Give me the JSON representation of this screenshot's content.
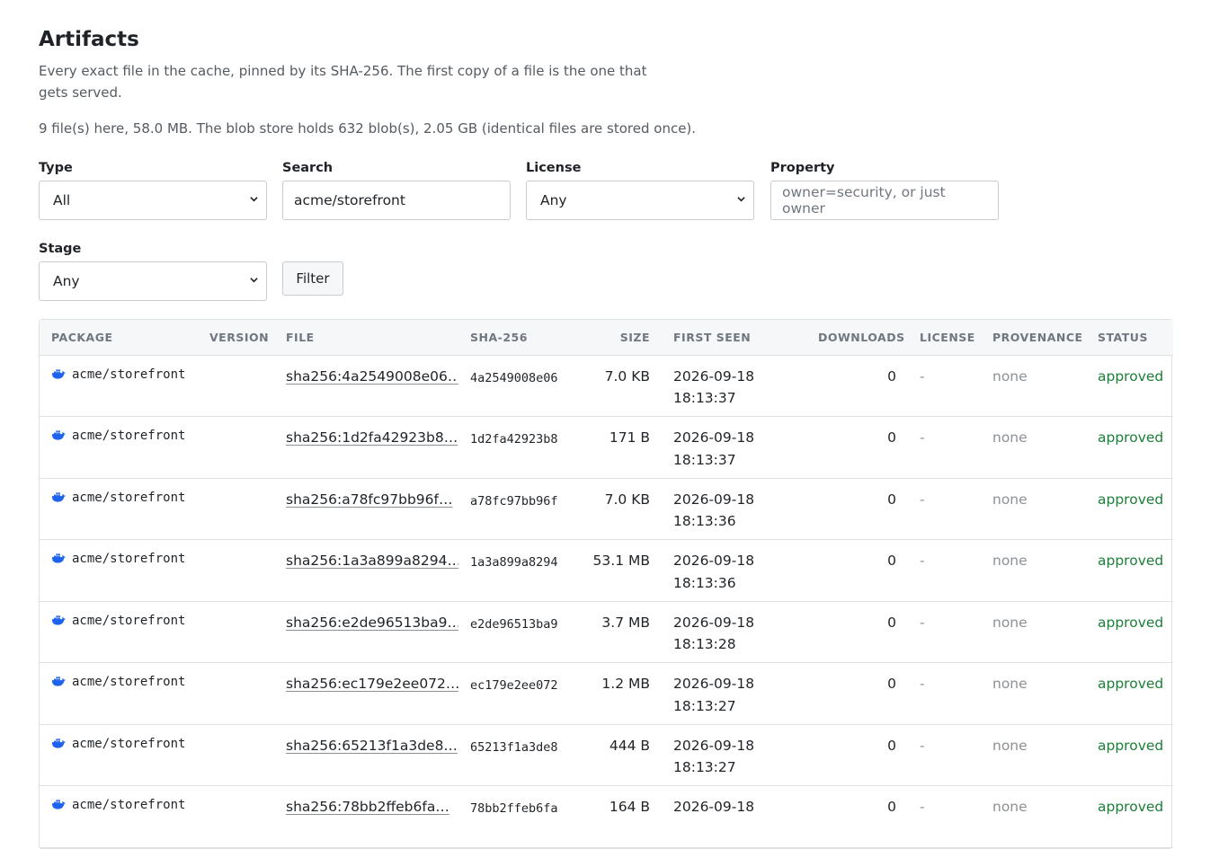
{
  "header": {
    "title": "Artifacts",
    "description": "Every exact file in the cache, pinned by its SHA-256. The first copy of a file is the one that gets served.",
    "stats": "9 file(s) here, 58.0 MB. The blob store holds 632 blob(s), 2.05 GB (identical files are stored once)."
  },
  "filters": {
    "type": {
      "label": "Type",
      "value": "All"
    },
    "search": {
      "label": "Search",
      "value": "acme/storefront"
    },
    "license": {
      "label": "License",
      "value": "Any"
    },
    "property": {
      "label": "Property",
      "placeholder": "owner=security, or just owner"
    },
    "stage": {
      "label": "Stage",
      "value": "Any"
    },
    "filter_button": "Filter"
  },
  "table": {
    "columns": {
      "package": "PACKAGE",
      "version": "VERSION",
      "file": "FILE",
      "sha": "SHA-256",
      "size": "SIZE",
      "first_seen": "FIRST SEEN",
      "downloads": "DOWNLOADS",
      "license": "LICENSE",
      "provenance": "PROVENANCE",
      "status": "STATUS"
    },
    "rows": [
      {
        "package": "acme/storefront",
        "version": "",
        "file": "sha256:4a2549008e06…",
        "sha": "4a2549008e06",
        "size": "7.0 KB",
        "first_seen": "2026-09-18 18:13:37",
        "downloads": "0",
        "license": "-",
        "provenance": "none",
        "status": "approved"
      },
      {
        "package": "acme/storefront",
        "version": "",
        "file": "sha256:1d2fa42923b8…",
        "sha": "1d2fa42923b8",
        "size": "171 B",
        "first_seen": "2026-09-18 18:13:37",
        "downloads": "0",
        "license": "-",
        "provenance": "none",
        "status": "approved"
      },
      {
        "package": "acme/storefront",
        "version": "",
        "file": "sha256:a78fc97bb96f…",
        "sha": "a78fc97bb96f",
        "size": "7.0 KB",
        "first_seen": "2026-09-18 18:13:36",
        "downloads": "0",
        "license": "-",
        "provenance": "none",
        "status": "approved"
      },
      {
        "package": "acme/storefront",
        "version": "",
        "file": "sha256:1a3a899a8294…",
        "sha": "1a3a899a8294",
        "size": "53.1 MB",
        "first_seen": "2026-09-18 18:13:36",
        "downloads": "0",
        "license": "-",
        "provenance": "none",
        "status": "approved"
      },
      {
        "package": "acme/storefront",
        "version": "",
        "file": "sha256:e2de96513ba9…",
        "sha": "e2de96513ba9",
        "size": "3.7 MB",
        "first_seen": "2026-09-18 18:13:28",
        "downloads": "0",
        "license": "-",
        "provenance": "none",
        "status": "approved"
      },
      {
        "package": "acme/storefront",
        "version": "",
        "file": "sha256:ec179e2ee072…",
        "sha": "ec179e2ee072",
        "size": "1.2 MB",
        "first_seen": "2026-09-18 18:13:27",
        "downloads": "0",
        "license": "-",
        "provenance": "none",
        "status": "approved"
      },
      {
        "package": "acme/storefront",
        "version": "",
        "file": "sha256:65213f1a3de8…",
        "sha": "65213f1a3de8",
        "size": "444 B",
        "first_seen": "2026-09-18 18:13:27",
        "downloads": "0",
        "license": "-",
        "provenance": "none",
        "status": "approved"
      },
      {
        "package": "acme/storefront",
        "version": "",
        "file": "sha256:78bb2ffeb6fa…",
        "sha": "78bb2ffeb6fa",
        "size": "164 B",
        "first_seen": "2026-09-18",
        "downloads": "0",
        "license": "-",
        "provenance": "none",
        "status": "approved"
      }
    ]
  },
  "icons": {
    "package_type": "docker-icon",
    "select_arrow": "chevron-down-icon"
  },
  "colors": {
    "status_approved": "#1a7f37",
    "muted": "#8c9196"
  }
}
